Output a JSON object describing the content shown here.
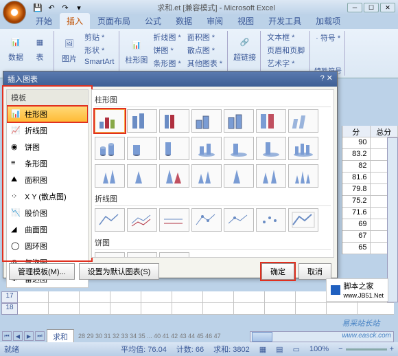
{
  "titlebar": {
    "filename": "求和.et",
    "mode": "[兼容模式]",
    "app": "- Microsoft Excel"
  },
  "tabs": [
    "开始",
    "插入",
    "页面布局",
    "公式",
    "数据",
    "审阅",
    "视图",
    "开发工具",
    "加载项"
  ],
  "active_tab": 1,
  "ribbon": {
    "group1": {
      "b1": "数据",
      "b2": "表"
    },
    "group2": {
      "b1": "图片",
      "small": [
        "剪贴 *",
        "形状 *",
        "SmartArt"
      ]
    },
    "group3": {
      "b1": "柱形图",
      "small": [
        "折线图 *",
        "饼图 *",
        "条形图 *"
      ],
      "small2": [
        "面积图 *",
        "散点图 *",
        "其他图表 *"
      ]
    },
    "group4": {
      "b1": "超链接"
    },
    "group5": {
      "small": [
        "文本框 *",
        "页眉和页脚",
        "艺术字 *"
      ]
    },
    "group6": {
      "b1": "· 符号 *",
      "label": "特殊符号"
    }
  },
  "dialog": {
    "title": "插入图表",
    "left_hdr": "模板",
    "categories": [
      "柱形图",
      "折线图",
      "饼图",
      "条形图",
      "面积图",
      "X Y (散点图)",
      "股价图",
      "曲面图",
      "圆环图",
      "气泡图",
      "雷达图"
    ],
    "selected_cat": 0,
    "sections": [
      "柱形图",
      "折线图",
      "饼图"
    ],
    "btn_template": "管理模板(M)...",
    "btn_default": "设置为默认图表(S)",
    "btn_ok": "确定",
    "btn_cancel": "取消"
  },
  "sheet": {
    "headers": [
      "分",
      "总分"
    ],
    "rows": [
      [
        "90",
        ""
      ],
      [
        "83.2",
        ""
      ],
      [
        "82",
        ""
      ],
      [
        "81.6",
        ""
      ],
      [
        "79.8",
        ""
      ],
      [
        "75.2",
        ""
      ],
      [
        "71.6",
        ""
      ],
      [
        "69",
        ""
      ],
      [
        "67",
        ""
      ],
      [
        "65",
        ""
      ]
    ],
    "row_ids": [
      "17",
      "18"
    ],
    "tabs_nav": "求和",
    "tab_nums": [
      28,
      29,
      30,
      31,
      32,
      33,
      34,
      35,
      40,
      41,
      42,
      43,
      44,
      45,
      46,
      47
    ]
  },
  "status": {
    "ready": "就绪",
    "avg": "平均值: 76.04",
    "count": "计数: 66",
    "sum": "求和: 3802",
    "zoom": "100%"
  },
  "watermarks": {
    "w1": "脚本之家",
    "w1b": "www.JB51.Net",
    "w2": "易采站长站",
    "w2b": "www.easck.com"
  }
}
